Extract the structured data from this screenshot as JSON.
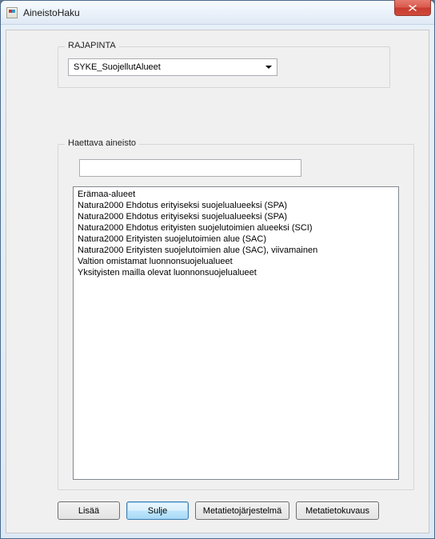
{
  "window": {
    "title": "AineistoHaku"
  },
  "rajapinta": {
    "label": "RAJAPINTA",
    "selected": "SYKE_SuojellutAlueet"
  },
  "haettava": {
    "label": "Haettava aineisto",
    "filter_value": "",
    "items": [
      "Erämaa-alueet",
      "Natura2000 Ehdotus erityiseksi suojelualueeksi (SPA)",
      "Natura2000 Ehdotus erityiseksi suojelualueeksi (SPA)",
      "Natura2000 Ehdotus erityisten suojelutoimien alueeksi (SCI)",
      "Natura2000 Erityisten suojelutoimien alue (SAC)",
      "Natura2000 Erityisten suojelutoimien alue (SAC), viivamainen",
      "Valtion omistamat luonnonsuojelualueet",
      "Yksityisten mailla olevat luonnonsuojelualueet"
    ]
  },
  "buttons": {
    "lisaa": "Lisää",
    "sulje": "Sulje",
    "metajarj": "Metatietojärjestelmä",
    "metakuvaus": "Metatietokuvaus"
  }
}
